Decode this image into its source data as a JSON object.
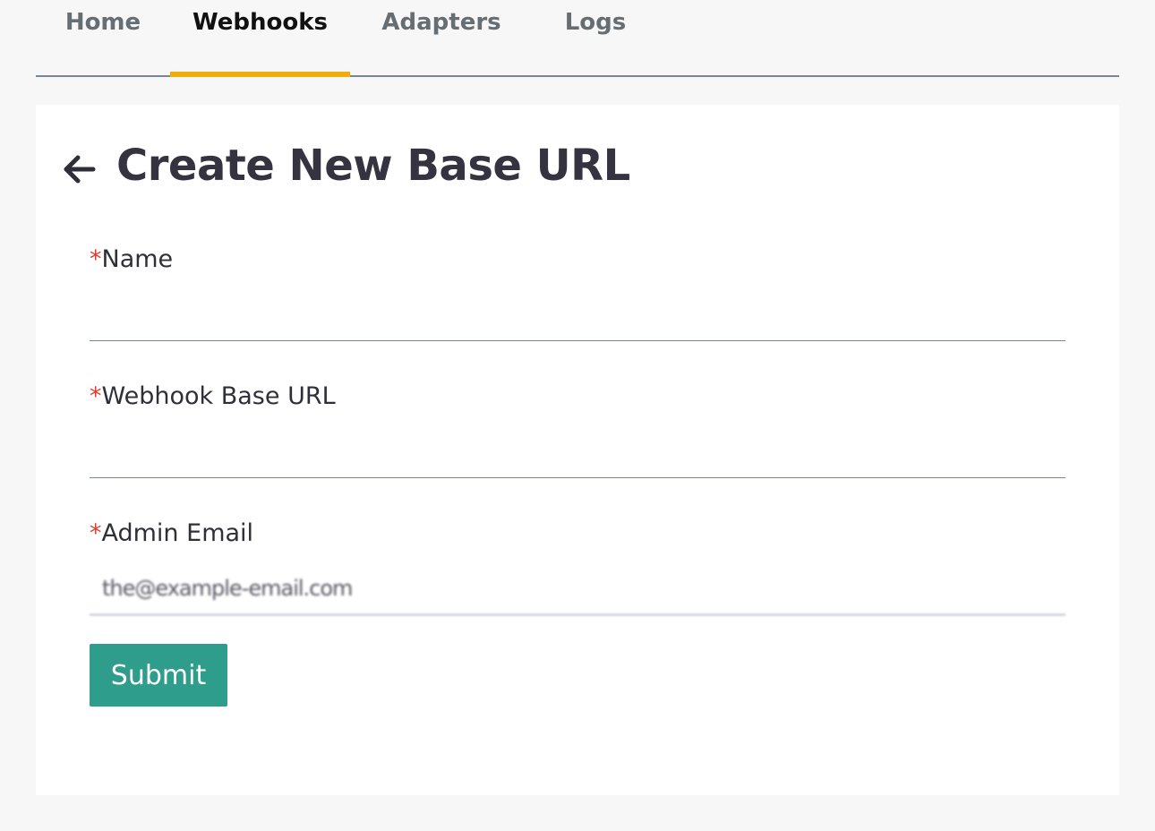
{
  "tabs": [
    {
      "label": "Home",
      "active": false
    },
    {
      "label": "Webhooks",
      "active": true
    },
    {
      "label": "Adapters",
      "active": false
    },
    {
      "label": "Logs",
      "active": false
    }
  ],
  "colors": {
    "active_tab_underline": "#f0ac0a",
    "required_marker": "#e33b2e",
    "submit_background": "#2f9d8c"
  },
  "page": {
    "back_icon": "arrow-left-icon",
    "title": "Create New Base URL"
  },
  "form": {
    "required_marker": "*",
    "name": {
      "label": "Name",
      "value": ""
    },
    "base_url": {
      "label": "Webhook Base URL",
      "value": ""
    },
    "admin_email": {
      "label": "Admin Email",
      "value": "the@example-email.com"
    },
    "submit_label": "Submit"
  }
}
